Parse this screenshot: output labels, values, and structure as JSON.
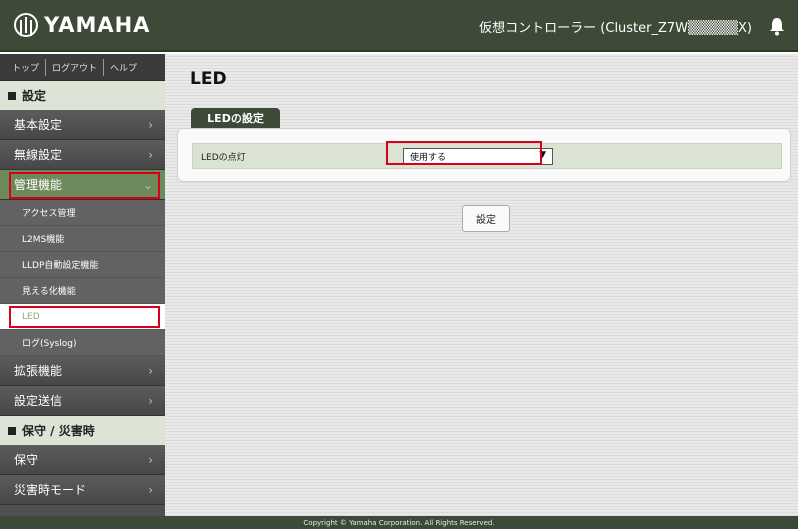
{
  "header": {
    "logo_text": "YAMAHA",
    "title": "仮想コントローラー (Cluster_Z7W▒▒▒▒▒X)"
  },
  "topnav": [
    "トップ",
    "ログアウト",
    "ヘルプ"
  ],
  "sidebar": {
    "section1": "設定",
    "items_a": [
      {
        "label": "基本設定"
      },
      {
        "label": "無線設定"
      },
      {
        "label": "管理機能"
      }
    ],
    "subitems": [
      {
        "label": "アクセス管理"
      },
      {
        "label": "L2MS機能"
      },
      {
        "label": "LLDP自動設定機能"
      },
      {
        "label": "見える化機能"
      },
      {
        "label": "LED"
      },
      {
        "label": "ログ(Syslog)"
      }
    ],
    "items_b": [
      {
        "label": "拡張機能"
      },
      {
        "label": "設定送信"
      }
    ],
    "section2": "保守 / 災害時",
    "items_c": [
      {
        "label": "保守"
      },
      {
        "label": "災害時モード"
      }
    ]
  },
  "main": {
    "page_title": "LED",
    "panel_title": "LEDの設定",
    "row_label": "LEDの点灯",
    "select_value": "使用する",
    "submit_label": "設定"
  },
  "footer": "Copyright © Yamaha Corporation. All Rights Reserved.",
  "colors": {
    "header_bg": "#3d4a38",
    "highlight": "#d9001b",
    "active_nav": "#6d8a5c"
  }
}
